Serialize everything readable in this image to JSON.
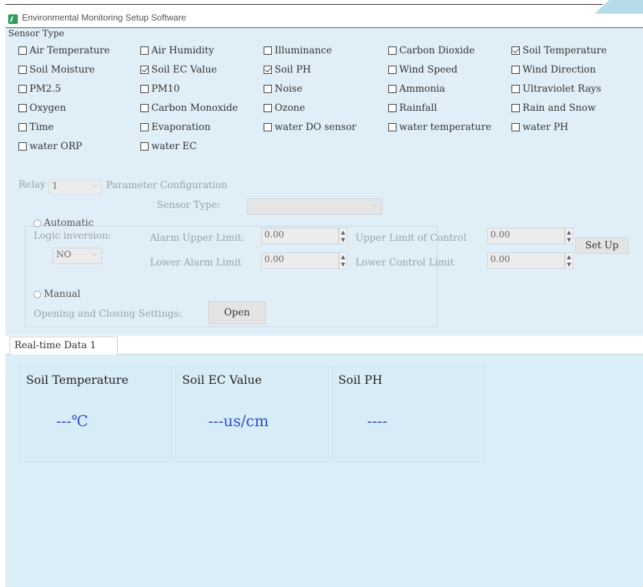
{
  "window": {
    "title": "Environmental Monitoring Setup Software"
  },
  "sensor_type": {
    "label": "Sensor Type",
    "items": [
      {
        "label": "Air Temperature",
        "checked": false
      },
      {
        "label": "Air Humidity",
        "checked": false
      },
      {
        "label": "Illuminance",
        "checked": false
      },
      {
        "label": "Carbon Dioxide",
        "checked": false
      },
      {
        "label": "Soil Temperature",
        "checked": true
      },
      {
        "label": "Soil Moisture",
        "checked": false
      },
      {
        "label": "Soil EC Value",
        "checked": true
      },
      {
        "label": "Soil PH",
        "checked": true
      },
      {
        "label": "Wind Speed",
        "checked": false
      },
      {
        "label": "Wind Direction",
        "checked": false
      },
      {
        "label": "PM2.5",
        "checked": false
      },
      {
        "label": "PM10",
        "checked": false
      },
      {
        "label": "Noise",
        "checked": false
      },
      {
        "label": "Ammonia",
        "checked": false
      },
      {
        "label": "Ultraviolet Rays",
        "checked": false
      },
      {
        "label": "Oxygen",
        "checked": false
      },
      {
        "label": "Carbon Monoxide",
        "checked": false
      },
      {
        "label": "Ozone",
        "checked": false
      },
      {
        "label": "Rainfall",
        "checked": false
      },
      {
        "label": "Rain and Snow",
        "checked": false
      },
      {
        "label": "Time",
        "checked": false
      },
      {
        "label": "Evaporation",
        "checked": false
      },
      {
        "label": "water DO sensor",
        "checked": false
      },
      {
        "label": "water temperature",
        "checked": false
      },
      {
        "label": "water PH",
        "checked": false
      },
      {
        "label": "water ORP",
        "checked": false
      },
      {
        "label": "water EC",
        "checked": false
      }
    ]
  },
  "relay": {
    "label": "Relay",
    "selected": "1",
    "config_label": "Parameter Configuration",
    "sensor_type_label": "Sensor Type:",
    "sensor_type_value": "",
    "automatic_label": "Automatic",
    "logic_inversion_label": "Logic inversion:",
    "logic_inversion_value": "NO",
    "alarm_upper_label": "Alarm Upper Limit:",
    "alarm_upper_value": "0.00",
    "alarm_lower_label": "Lower Alarm Limit",
    "alarm_lower_value": "0.00",
    "control_upper_label": "Upper Limit of Control",
    "control_upper_value": "0.00",
    "control_lower_label": "Lower Control Limit",
    "control_lower_value": "0.00",
    "setup_button": "Set Up",
    "manual_label": "Manual",
    "open_close_label": "Opening and Closing Settings:",
    "open_button": "Open"
  },
  "tabs": [
    {
      "label": "Real-time Data 1"
    }
  ],
  "cards": [
    {
      "title": "Soil Temperature",
      "value": "---℃"
    },
    {
      "title": "Soil EC Value",
      "value": "---us/cm"
    },
    {
      "title": "Soil PH",
      "value": "----"
    }
  ],
  "colors": {
    "panel_bg": "#dfeef7",
    "value_blue": "#3050c8",
    "icon_green": "#2f9e5a"
  }
}
